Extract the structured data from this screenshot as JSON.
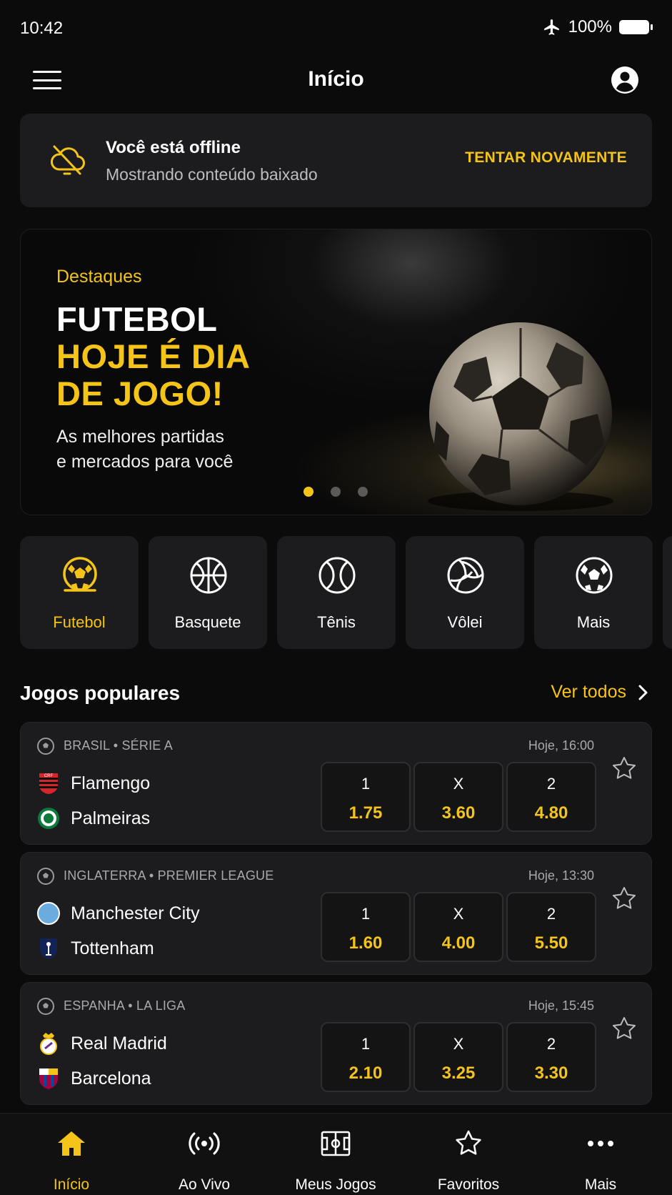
{
  "status_bar": {
    "time": "10:42",
    "battery": "100%"
  },
  "header": {
    "title": "Início"
  },
  "offline_banner": {
    "title": "Você está offline",
    "subtitle": "Mostrando conteúdo baixado",
    "retry_label": "TENTAR NOVAMENTE"
  },
  "hero": {
    "eyebrow": "Destaques",
    "line1": "FUTEBOL",
    "line2": "HOJE É DIA",
    "line3": "DE JOGO!",
    "subtitle_line1": "As melhores partidas",
    "subtitle_line2": "e mercados para você",
    "slides_count": 3,
    "active_slide": 1
  },
  "sports": [
    {
      "label": "Futebol",
      "icon": "soccer-ball-icon",
      "active": true
    },
    {
      "label": "Basquete",
      "icon": "basketball-icon",
      "active": false
    },
    {
      "label": "Tênis",
      "icon": "tennis-ball-icon",
      "active": false
    },
    {
      "label": "Vôlei",
      "icon": "volleyball-icon",
      "active": false
    },
    {
      "label": "Mais",
      "icon": "more-sports-icon",
      "active": false
    }
  ],
  "popular": {
    "title": "Jogos populares",
    "see_all_label": "Ver todos"
  },
  "matches": [
    {
      "league": "BRASIL • SÉRIE A",
      "time": "Hoje, 16:00",
      "home": "Flamengo",
      "away": "Palmeiras",
      "odds": [
        {
          "label": "1",
          "value": "1.75"
        },
        {
          "label": "X",
          "value": "3.60"
        },
        {
          "label": "2",
          "value": "4.80"
        }
      ]
    },
    {
      "league": "INGLATERRA • PREMIER LEAGUE",
      "time": "Hoje, 13:30",
      "home": "Manchester City",
      "away": "Tottenham",
      "odds": [
        {
          "label": "1",
          "value": "1.60"
        },
        {
          "label": "X",
          "value": "4.00"
        },
        {
          "label": "2",
          "value": "5.50"
        }
      ]
    },
    {
      "league": "ESPANHA • LA LIGA",
      "time": "Hoje, 15:45",
      "home": "Real Madrid",
      "away": "Barcelona",
      "odds": [
        {
          "label": "1",
          "value": "2.10"
        },
        {
          "label": "X",
          "value": "3.25"
        },
        {
          "label": "2",
          "value": "3.30"
        }
      ]
    }
  ],
  "bottom_nav": [
    {
      "label": "Início",
      "icon": "home-icon",
      "active": true
    },
    {
      "label": "Ao Vivo",
      "icon": "live-broadcast-icon",
      "active": false
    },
    {
      "label": "Meus Jogos",
      "icon": "pitch-icon",
      "active": false
    },
    {
      "label": "Favoritos",
      "icon": "star-icon",
      "active": false
    },
    {
      "label": "Mais",
      "icon": "more-dots-icon",
      "active": false
    }
  ],
  "colors": {
    "accent": "#f5c418",
    "background": "#0b0b0c",
    "card": "#1c1c1e",
    "text": "#ffffff",
    "muted": "#a9a9a9"
  }
}
